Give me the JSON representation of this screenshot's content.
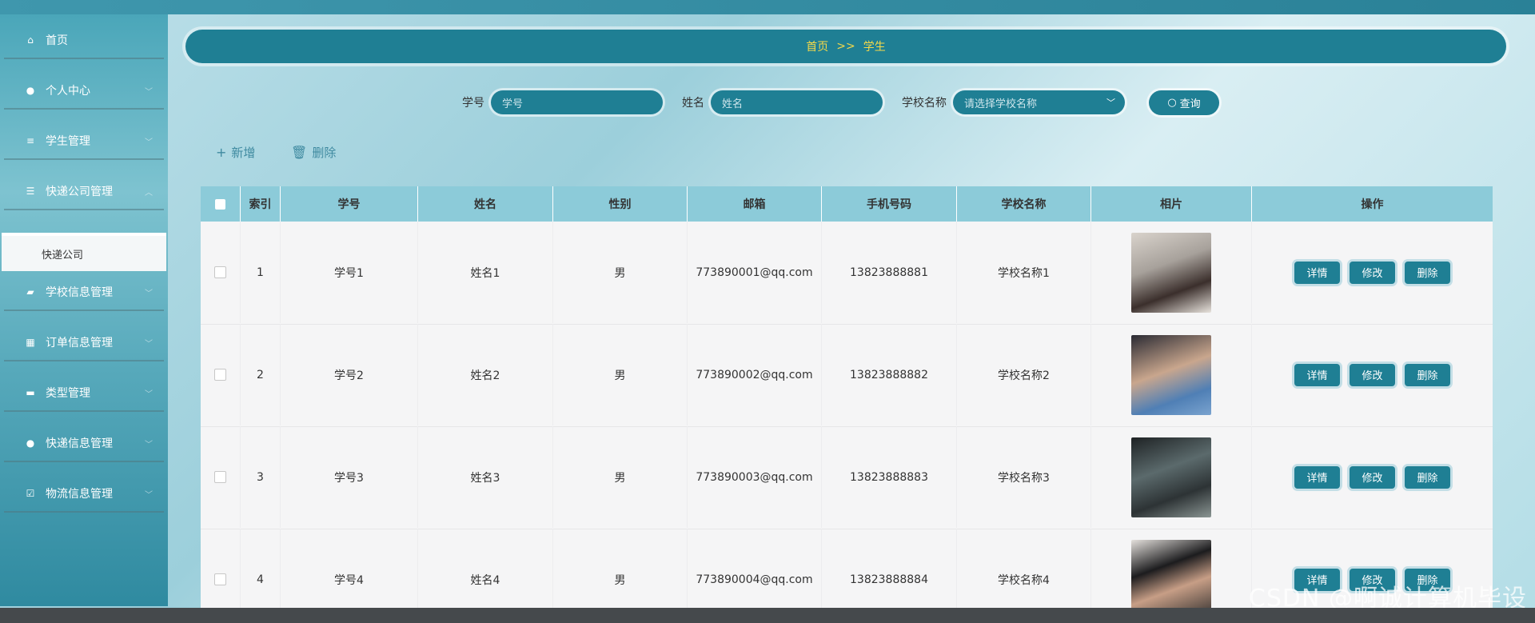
{
  "sidebar": {
    "items": [
      {
        "label": "首页",
        "icon": "home-icon"
      },
      {
        "label": "个人中心",
        "icon": "user-icon"
      },
      {
        "label": "学生管理",
        "icon": "sliders-icon"
      },
      {
        "label": "快递公司管理",
        "icon": "list-icon"
      },
      {
        "label": "学校信息管理",
        "icon": "message-icon"
      },
      {
        "label": "订单信息管理",
        "icon": "grid-icon"
      },
      {
        "label": "类型管理",
        "icon": "flag-icon"
      },
      {
        "label": "快递信息管理",
        "icon": "user-icon"
      },
      {
        "label": "物流信息管理",
        "icon": "checkbox-icon"
      }
    ],
    "submenu": {
      "label": "快递公司"
    }
  },
  "breadcrumb": {
    "home": "首页",
    "separator": ">>",
    "current": "学生"
  },
  "search": {
    "student_no_label": "学号",
    "student_no_placeholder": "学号",
    "name_label": "姓名",
    "name_placeholder": "姓名",
    "school_label": "学校名称",
    "school_placeholder": "请选择学校名称",
    "query_button": "查询"
  },
  "toolbar": {
    "add_label": "新增",
    "delete_label": "删除"
  },
  "table": {
    "headers": [
      "索引",
      "学号",
      "姓名",
      "性别",
      "邮箱",
      "手机号码",
      "学校名称",
      "相片",
      "操作"
    ],
    "rows": [
      {
        "index": "1",
        "student_no": "学号1",
        "name": "姓名1",
        "gender": "男",
        "email": "773890001@qq.com",
        "phone": "13823888881",
        "school": "学校名称1"
      },
      {
        "index": "2",
        "student_no": "学号2",
        "name": "姓名2",
        "gender": "男",
        "email": "773890002@qq.com",
        "phone": "13823888882",
        "school": "学校名称2"
      },
      {
        "index": "3",
        "student_no": "学号3",
        "name": "姓名3",
        "gender": "男",
        "email": "773890003@qq.com",
        "phone": "13823888883",
        "school": "学校名称3"
      },
      {
        "index": "4",
        "student_no": "学号4",
        "name": "姓名4",
        "gender": "男",
        "email": "773890004@qq.com",
        "phone": "13823888884",
        "school": "学校名称4"
      }
    ],
    "actions": {
      "detail": "详情",
      "edit": "修改",
      "delete": "删除"
    }
  },
  "watermark": "CSDN @啊诚计算机毕设",
  "colors": {
    "primary": "#1f7f94",
    "breadcrumb_text": "#f4d94a",
    "header_bg": "#8ccbd9"
  }
}
